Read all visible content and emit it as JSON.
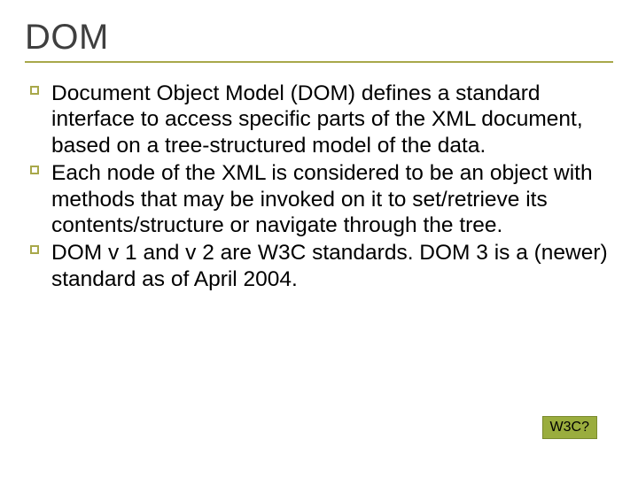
{
  "title": "DOM",
  "bullets": [
    "Document Object Model (DOM) defines a standard interface to access specific parts of the XML document, based on a tree-structured model of the data.",
    "Each node of the XML is considered to be an object with methods that may be invoked on it to set/retrieve its contents/structure or navigate through the tree.",
    "DOM v 1 and v 2 are W3C standards. DOM 3 is a (newer) standard as of April 2004."
  ],
  "badge": "W3C?"
}
